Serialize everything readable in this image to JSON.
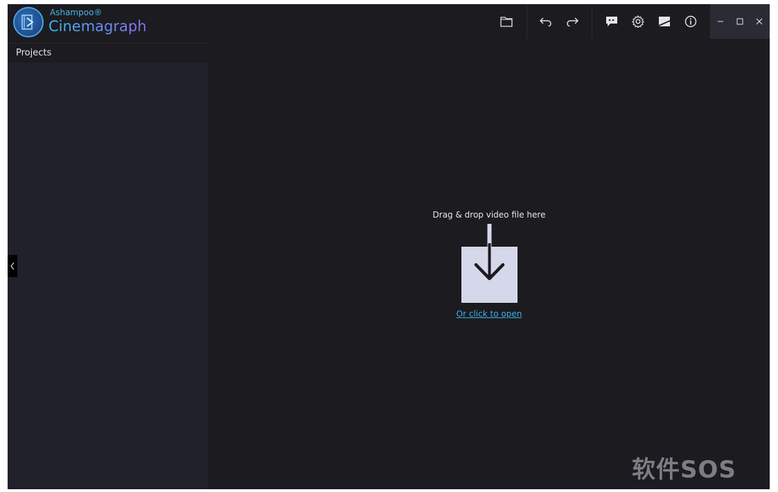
{
  "app": {
    "brand_small": "Ashampoo®",
    "brand_name": "Cinemagraph"
  },
  "toolbar": {
    "icons": [
      "folder-icon",
      "undo-icon",
      "redo-icon",
      "feedback-icon",
      "settings-icon",
      "chart-icon",
      "info-icon"
    ]
  },
  "window_controls": {
    "icons": [
      "minimize-icon",
      "maximize-icon",
      "close-icon"
    ]
  },
  "sidebar": {
    "header": "Projects"
  },
  "dropzone": {
    "text": "Drag & drop video file here",
    "link": "Or click to open"
  },
  "watermark": {
    "text": "软件SOS"
  },
  "colors": {
    "background": "#1b1b20",
    "sidebar": "#20212a",
    "accent": "#3fb0e6",
    "dropbox": "#d5d7ea"
  }
}
